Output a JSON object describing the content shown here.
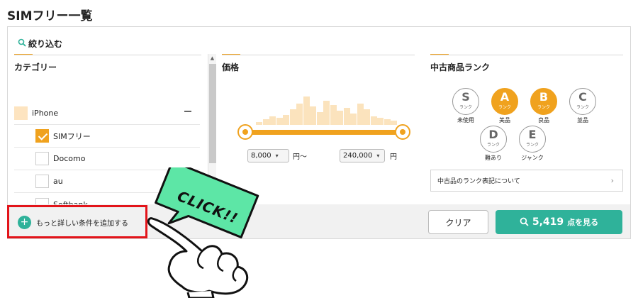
{
  "page_title": "SIMフリー一覧",
  "filter": {
    "header": "絞り込む",
    "icon": "search-icon"
  },
  "category": {
    "title": "カテゴリー",
    "items": [
      {
        "label": "iPhone",
        "state": "parent-expanded"
      },
      {
        "label": "SIMフリー",
        "state": "checked"
      },
      {
        "label": "Docomo",
        "state": "unchecked"
      },
      {
        "label": "au",
        "state": "unchecked"
      },
      {
        "label": "Softbank",
        "state": "unchecked"
      }
    ]
  },
  "price": {
    "title": "価格",
    "min_value": "8,000",
    "min_unit": "円〜",
    "max_value": "240,000",
    "max_unit": "円"
  },
  "rank": {
    "title": "中古商品ランク",
    "items": [
      {
        "letter": "S",
        "sub": "ランク",
        "label": "未使用",
        "selected": false
      },
      {
        "letter": "A",
        "sub": "ランク",
        "label": "美品",
        "selected": true
      },
      {
        "letter": "B",
        "sub": "ランク",
        "label": "良品",
        "selected": true
      },
      {
        "letter": "C",
        "sub": "ランク",
        "label": "並品",
        "selected": false
      },
      {
        "letter": "D",
        "sub": "ランク",
        "label": "難あり",
        "selected": false
      },
      {
        "letter": "E",
        "sub": "ランク",
        "label": "ジャンク",
        "selected": false
      }
    ],
    "note_link": "中古品のランク表記について"
  },
  "actions": {
    "more_conditions": "もっと詳しい条件を追加する",
    "clear": "クリア",
    "result_count": "5,419",
    "result_suffix": "点を見る"
  },
  "callout": {
    "text": "CLICK!!"
  },
  "colors": {
    "accent": "#f0a21e",
    "teal": "#2fb29a",
    "highlight": "#e3141a",
    "callout_green": "#5de6a6"
  }
}
